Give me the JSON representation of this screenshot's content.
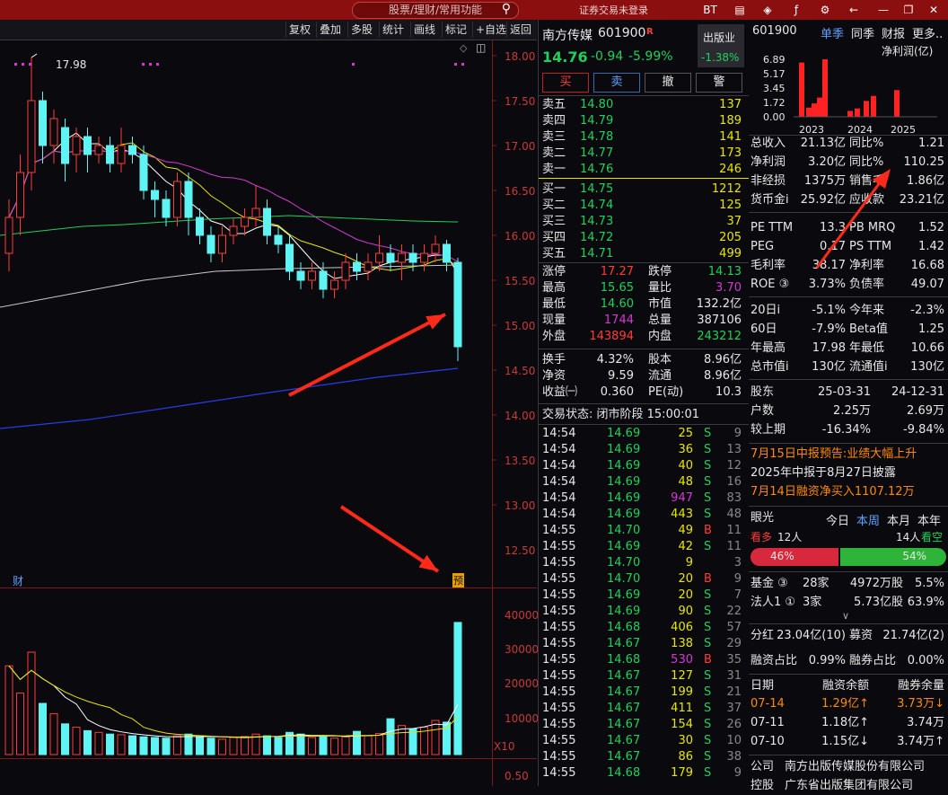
{
  "topbar": {
    "search_placeholder": "股票/理财/常用功能",
    "login_status": "证券交易未登录",
    "icons": [
      "BT",
      "chart-icon",
      "cube-icon",
      "fx-icon",
      "gear-icon",
      "back-icon",
      "minimize-icon",
      "restore-icon",
      "close-icon"
    ]
  },
  "toolbar": {
    "items": [
      "复权",
      "叠加",
      "多股",
      "统计",
      "画线",
      "标记",
      "+自选",
      "返回"
    ]
  },
  "kline": {
    "price_labels": [
      "18.00",
      "17.50",
      "17.00",
      "16.50",
      "16.00",
      "15.50",
      "15.00",
      "14.50",
      "14.00",
      "13.50",
      "13.00",
      "12.50"
    ],
    "volume_labels": [
      "40000",
      "30000",
      "20000",
      "10000"
    ],
    "volume_unit": "X10",
    "bottom_label": "0.50",
    "high_marker": "17.98",
    "left_marker": "财",
    "right_marker": "预",
    "colors": {
      "up": "#ff3b3b",
      "down": "#5ff4f4",
      "ma5": "#ffffff",
      "ma10": "#e6e600",
      "ma20": "#d13bd1",
      "ma60": "#1fd15c",
      "ma120": "#c8c8c8",
      "ma250": "#2a3ae8"
    },
    "candles": [
      [
        15.8,
        16.2,
        16.4,
        15.6
      ],
      [
        16.2,
        16.7,
        16.9,
        16.0
      ],
      [
        16.7,
        17.5,
        17.98,
        16.5
      ],
      [
        17.5,
        17.0,
        17.6,
        16.8
      ],
      [
        17.0,
        17.3,
        17.4,
        16.8
      ],
      [
        17.2,
        16.8,
        17.3,
        16.6
      ],
      [
        16.9,
        17.1,
        17.2,
        16.7
      ],
      [
        17.1,
        16.9,
        17.2,
        16.7
      ],
      [
        16.9,
        17.0,
        17.1,
        16.8
      ],
      [
        17.0,
        16.8,
        17.1,
        16.7
      ],
      [
        16.8,
        17.0,
        17.2,
        16.7
      ],
      [
        17.0,
        16.9,
        17.1,
        16.8
      ],
      [
        16.9,
        16.5,
        17.0,
        16.4
      ],
      [
        16.5,
        16.4,
        16.6,
        16.2
      ],
      [
        16.4,
        16.2,
        16.5,
        16.1
      ],
      [
        16.2,
        16.6,
        16.7,
        16.1
      ],
      [
        16.6,
        16.2,
        16.7,
        16.0
      ],
      [
        16.2,
        16.0,
        16.3,
        15.9
      ],
      [
        16.0,
        15.8,
        16.1,
        15.7
      ],
      [
        15.8,
        16.0,
        16.1,
        15.7
      ],
      [
        16.0,
        16.1,
        16.2,
        15.9
      ],
      [
        16.1,
        16.2,
        16.3,
        16.0
      ],
      [
        16.2,
        16.3,
        16.55,
        16.1
      ],
      [
        16.3,
        16.0,
        16.4,
        15.9
      ],
      [
        16.0,
        15.9,
        16.1,
        15.8
      ],
      [
        15.9,
        15.6,
        16.0,
        15.5
      ],
      [
        15.6,
        15.5,
        15.7,
        15.4
      ],
      [
        15.5,
        15.6,
        15.7,
        15.4
      ],
      [
        15.6,
        15.4,
        15.7,
        15.3
      ],
      [
        15.4,
        15.5,
        15.6,
        15.3
      ],
      [
        15.5,
        15.7,
        15.8,
        15.4
      ],
      [
        15.7,
        15.6,
        15.8,
        15.5
      ],
      [
        15.6,
        15.7,
        15.8,
        15.5
      ],
      [
        15.7,
        15.8,
        16.0,
        15.6
      ],
      [
        15.8,
        15.7,
        15.9,
        15.6
      ],
      [
        15.7,
        15.8,
        15.9,
        15.5
      ],
      [
        15.8,
        15.7,
        15.9,
        15.6
      ],
      [
        15.7,
        15.8,
        15.9,
        15.6
      ],
      [
        15.8,
        15.9,
        16.0,
        15.7
      ],
      [
        15.9,
        15.7,
        15.95,
        15.6
      ],
      [
        15.7,
        14.76,
        15.75,
        14.6
      ]
    ],
    "volumes": [
      26000,
      18000,
      30000,
      15000,
      12000,
      9000,
      8000,
      7000,
      6500,
      6000,
      5800,
      5500,
      5200,
      5000,
      4800,
      5500,
      6000,
      5200,
      4800,
      4500,
      5000,
      5300,
      6000,
      5500,
      5000,
      6500,
      6000,
      5000,
      5500,
      4800,
      5200,
      6800,
      5500,
      6200,
      10500,
      8500,
      7500,
      8000,
      10000,
      9500,
      38710
    ]
  },
  "quote": {
    "name": "南方传媒",
    "code": "601900",
    "badge": "R",
    "price": "14.76",
    "change": "-0.94",
    "change_pct": "-5.99%",
    "sector": "出版业",
    "sector_change": "-1.38%",
    "actions": [
      "买",
      "卖",
      "撤",
      "警"
    ],
    "sell": [
      {
        "label": "卖五",
        "price": "14.80",
        "vol": "137"
      },
      {
        "label": "卖四",
        "price": "14.79",
        "vol": "189"
      },
      {
        "label": "卖三",
        "price": "14.78",
        "vol": "141"
      },
      {
        "label": "卖二",
        "price": "14.77",
        "vol": "173"
      },
      {
        "label": "卖一",
        "price": "14.76",
        "vol": "246"
      }
    ],
    "buy": [
      {
        "label": "买一",
        "price": "14.75",
        "vol": "1212"
      },
      {
        "label": "买二",
        "price": "14.74",
        "vol": "125"
      },
      {
        "label": "买三",
        "price": "14.73",
        "vol": "37"
      },
      {
        "label": "买四",
        "price": "14.72",
        "vol": "205"
      },
      {
        "label": "买五",
        "price": "14.71",
        "vol": "499"
      }
    ],
    "stats": [
      [
        "涨停",
        "17.27",
        "跌停",
        "14.13"
      ],
      [
        "最高",
        "15.65",
        "量比",
        "3.70"
      ],
      [
        "最低",
        "14.60",
        "市值",
        "132.2亿"
      ],
      [
        "现量",
        "1744",
        "总量",
        "387106"
      ],
      [
        "外盘",
        "143894",
        "内盘",
        "243212"
      ]
    ],
    "stats2": [
      [
        "换手",
        "4.32%",
        "股本",
        "8.96亿"
      ],
      [
        "净资",
        "9.59",
        "流通",
        "8.96亿"
      ],
      [
        "收益㈠",
        "0.360",
        "PE(动)",
        "10.3"
      ]
    ],
    "trade_status": "交易状态: 闭市阶段 15:00:01",
    "ticks": [
      [
        "14:54",
        "14.69",
        "25",
        "S",
        "9"
      ],
      [
        "14:54",
        "14.69",
        "36",
        "S",
        "13"
      ],
      [
        "14:54",
        "14.69",
        "40",
        "S",
        "12"
      ],
      [
        "14:54",
        "14.69",
        "48",
        "S",
        "16"
      ],
      [
        "14:54",
        "14.69",
        "947",
        "S",
        "83"
      ],
      [
        "14:54",
        "14.69",
        "443",
        "S",
        "48"
      ],
      [
        "14:55",
        "14.70",
        "49",
        "B",
        "11"
      ],
      [
        "14:55",
        "14.69",
        "42",
        "S",
        "11"
      ],
      [
        "14:55",
        "14.70",
        "9",
        "",
        "3"
      ],
      [
        "14:55",
        "14.70",
        "20",
        "B",
        "9"
      ],
      [
        "14:55",
        "14.69",
        "20",
        "S",
        "7"
      ],
      [
        "14:55",
        "14.69",
        "90",
        "S",
        "22"
      ],
      [
        "14:55",
        "14.68",
        "406",
        "S",
        "57"
      ],
      [
        "14:55",
        "14.67",
        "138",
        "S",
        "29"
      ],
      [
        "14:55",
        "14.68",
        "530",
        "B",
        "35"
      ],
      [
        "14:55",
        "14.67",
        "127",
        "S",
        "31"
      ],
      [
        "14:55",
        "14.67",
        "199",
        "S",
        "21"
      ],
      [
        "14:55",
        "14.67",
        "411",
        "S",
        "37"
      ],
      [
        "14:55",
        "14.67",
        "154",
        "S",
        "26"
      ],
      [
        "14:55",
        "14.67",
        "30",
        "S",
        "10"
      ],
      [
        "14:55",
        "14.67",
        "86",
        "S",
        "38"
      ],
      [
        "14:55",
        "14.68",
        "179",
        "S",
        "9"
      ]
    ]
  },
  "right": {
    "code": "601900",
    "tabs": [
      "单季",
      "同季",
      "财报",
      "更多.."
    ],
    "chart_title": "净利润(亿)",
    "chart_data": {
      "type": "bar",
      "yticks": [
        "6.89",
        "5.17",
        "3.45",
        "1.72",
        "0.00"
      ],
      "x_labels": [
        "2023",
        "2024",
        "2025"
      ],
      "values": [
        6.5,
        1.1,
        1.6,
        2.3,
        6.89,
        0.7,
        1.0,
        1.9,
        2.5,
        3.2
      ],
      "ylim": [
        0,
        6.89
      ]
    },
    "fin": [
      [
        "总收入",
        "21.13亿",
        "同比%",
        "1.21"
      ],
      [
        "净利润",
        "3.20亿",
        "同比%",
        "110.25"
      ],
      [
        "非经损",
        "1375万",
        "销售毛",
        "1.86亿"
      ],
      [
        "货币金i",
        "25.92亿",
        "应收款",
        "23.21亿"
      ]
    ],
    "val": [
      [
        "PE TTM",
        "13.3",
        "PB MRQ",
        "1.52"
      ],
      [
        "PEG",
        "0.17",
        "PS TTM",
        "1.42"
      ],
      [
        "毛利率",
        "38.17",
        "净利率",
        "16.68"
      ],
      [
        "ROE ③",
        "3.73%",
        "负债率",
        "49.07"
      ]
    ],
    "perf": [
      [
        "20日i",
        "-5.1%",
        "今年来",
        "-2.3%"
      ],
      [
        "60日",
        "-7.9%",
        "Beta值",
        "1.25"
      ],
      [
        "年最高",
        "17.98",
        "年最低",
        "10.66"
      ],
      [
        "总市值i",
        "130亿",
        "流通值i",
        "130亿"
      ]
    ],
    "holders": [
      [
        "股东",
        "25-03-31",
        "24-12-31"
      ],
      [
        "户数",
        "2.25万",
        "2.69万"
      ],
      [
        "较上期",
        "-16.34%",
        "-9.84%"
      ]
    ],
    "news": [
      "7月15日中报预告:业绩大幅上升",
      "2025年中报于8月27日披露",
      "7月14日融资净买入1107.12万"
    ],
    "sentiment": {
      "title": "眼光",
      "tabs": [
        "今日",
        "本周",
        "本月",
        "本年"
      ],
      "bull_label": "看多",
      "bull_count": "12人",
      "bear_label": "看空",
      "bear_count": "14人",
      "bull_pct": "46%",
      "bear_pct": "54%",
      "bull_value": 46
    },
    "fund": [
      [
        "基金 ③",
        "28家",
        "4972万股",
        "5.5%"
      ],
      [
        "法人1 ①",
        "3家",
        "5.73亿股",
        "63.9%"
      ]
    ],
    "div": [
      "分红",
      "23.04亿(10)",
      "募资",
      "21.74亿(2)"
    ],
    "margin": [
      "融资占比",
      "0.99%",
      "融券占比",
      "0.00%"
    ],
    "margin_head": [
      "日期",
      "融资余额",
      "融券余量"
    ],
    "margin_rows": [
      [
        "07-14",
        "1.29亿↑",
        "3.73万↓"
      ],
      [
        "07-11",
        "1.18亿↑",
        "3.74万"
      ],
      [
        "07-10",
        "1.15亿↓",
        "3.74万↑"
      ]
    ],
    "company": [
      "公司",
      "南方出版传媒股份有限公司"
    ],
    "controller": [
      "控股",
      "广东省出版集团有限公司"
    ]
  }
}
